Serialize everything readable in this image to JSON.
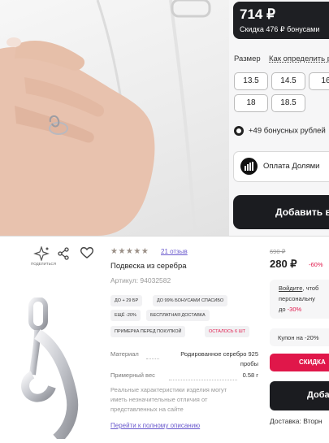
{
  "top": {
    "price": "714 ₽",
    "price_discount": "Скидка 476 ₽ бонусами",
    "size_label": "Размер",
    "size_link": "Как определить р",
    "sizes": [
      "13.5",
      "14.5",
      "16",
      "18",
      "18.5"
    ],
    "bonus_text": "+49 бонусных рублей",
    "payment_text": "Оплата Долями",
    "cart_button": "Добавить в"
  },
  "bottom": {
    "share_label": "поделиться",
    "rating_count": "21 отзыв",
    "product_title": "Подвеска из серебра",
    "article": "Артикул: 94032582",
    "chips": {
      "bonus_29": "до + 29 БР",
      "bonus_99": "до 99% бонусами спасибо",
      "more_20": "ещё -20%",
      "free_delivery": "бесплатная доставка",
      "fitting": "примерка перед покупкой",
      "left_6": "осталось 6 шт"
    },
    "specs": {
      "material_name": "Материал",
      "material_value_1": "Родированное серебро 925",
      "material_value_2": "пробы",
      "weight_name": "Примерный вес",
      "weight_value": "0.58 г"
    },
    "disclaimer_1": "Реальные характеристики изделия могут",
    "disclaimer_2": "иметь незначительные отличия от",
    "disclaimer_3": "представленных на сайте",
    "full_description_link": "Перейти к полному описанию",
    "old_price": "690 ₽",
    "price": "280 ₽",
    "discount": "-60%",
    "promo_link": "Войдите",
    "promo_text_1": ", чтоб",
    "promo_text_2": "персональну",
    "promo_text_3": "до",
    "promo_percent": "-30%",
    "coupon": "Купон на -20%",
    "discount_button": "СКИДКА",
    "add_button": "Доба",
    "delivery": "Доставка: Вторн"
  },
  "colors": {
    "dark_button": "#1b1c20",
    "accent_red": "#e0174a",
    "rating_star": "#9a8f86",
    "link_violet": "#6a5acd"
  }
}
